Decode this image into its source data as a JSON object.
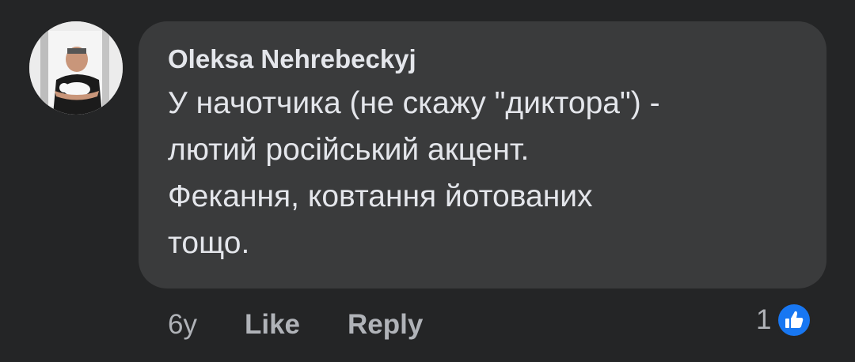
{
  "comment": {
    "author": "Oleksa Nehrebeckyj",
    "text": "У начотчика (не скажу \"диктора\") -\nлютий російський акцент.\nФекання, ковтання йотованих\nтощо.",
    "avatar_icon": "user-photo-avatar"
  },
  "actions": {
    "time": "6y",
    "like_label": "Like",
    "reply_label": "Reply"
  },
  "reactions": {
    "count": "1",
    "icon": "thumbs-up-icon",
    "color": "#1877f2"
  },
  "colors": {
    "background": "#242526",
    "bubble": "#3a3b3c",
    "primary_text": "#e4e6eb",
    "secondary_text": "#b0b3b8"
  }
}
